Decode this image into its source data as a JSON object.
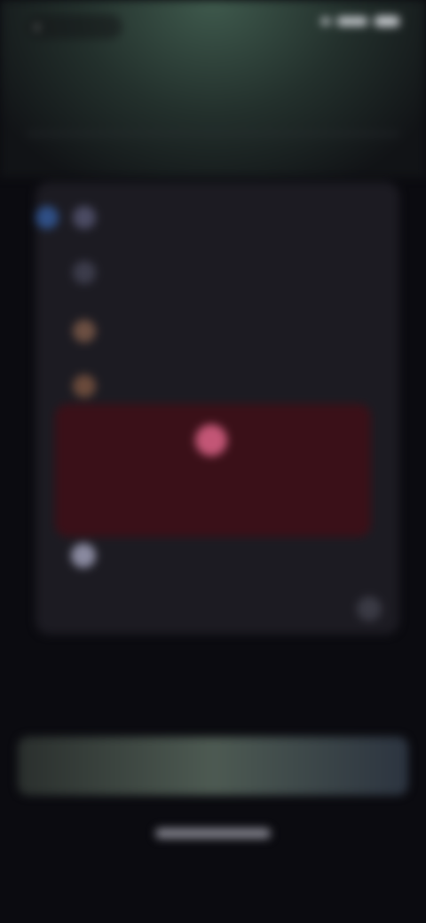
{
  "status": {
    "back_label": "",
    "time": ""
  },
  "list": [
    {
      "label": ""
    },
    {
      "label": ""
    },
    {
      "label": ""
    },
    {
      "label": ""
    }
  ],
  "alert": {
    "message": ""
  },
  "toggle": {
    "label": ""
  },
  "footer": {
    "label": ""
  },
  "help": {
    "link": ""
  },
  "cta": {
    "label": ""
  },
  "colors": {
    "accent": "#2f4f86",
    "alert_bg": "#3a1018",
    "alert_icon": "#c35676"
  }
}
